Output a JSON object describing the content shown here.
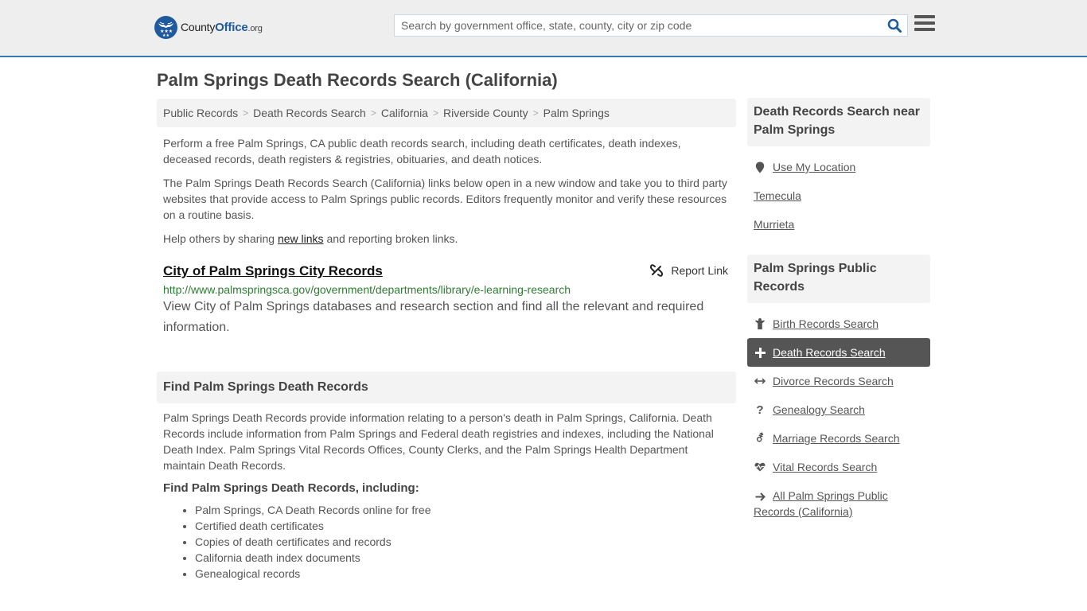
{
  "header": {
    "logo": {
      "name_prefix": "County",
      "name_brand": "Office",
      "name_suffix": ".org"
    },
    "search": {
      "placeholder": "Search by government office, state, county, city or zip code",
      "value": ""
    },
    "colors": {
      "brand": "#1f5a9f",
      "accent_border": "#337ab7",
      "header_bg": "#eeeeee"
    }
  },
  "page": {
    "title": "Palm Springs Death Records Search (California)"
  },
  "breadcrumb": [
    {
      "label": "Public Records"
    },
    {
      "label": "Death Records Search"
    },
    {
      "label": "California"
    },
    {
      "label": "Riverside County"
    },
    {
      "label": "Palm Springs"
    }
  ],
  "breadcrumb_separator": ">",
  "intro": {
    "p1": "Perform a free Palm Springs, CA public death records search, including death certificates, death indexes, deceased records, death registers & registries, obituaries, and death notices.",
    "p2": "The Palm Springs Death Records Search (California) links below open in a new window and take you to third party websites that provide access to Palm Springs public records. Editors frequently monitor and verify these resources on a routine basis.",
    "p3_before": "Help others by sharing ",
    "p3_link": "new links",
    "p3_after": " and reporting broken links."
  },
  "links": [
    {
      "title": "City of Palm Springs City Records",
      "url": "http://www.palmspringsca.gov/government/departments/library/e-learning-research",
      "description": "View City of Palm Springs databases and research section and find all the relevant and required information.",
      "report_label": "Report Link",
      "report_icon": "unlink-icon"
    }
  ],
  "find_section": {
    "heading": "Find Palm Springs Death Records",
    "body": "Palm Springs Death Records provide information relating to a person's death in Palm Springs, California. Death Records include information from Palm Springs and Federal death registries and indexes, including the National Death Index. Palm Springs Vital Records Offices, County Clerks, and the Palm Springs Health Department maintain Death Records.",
    "subheading": "Find Palm Springs Death Records, including:",
    "items": [
      "Palm Springs, CA Death Records online for free",
      "Certified death certificates",
      "Copies of death certificates and records",
      "California death index documents",
      "Genealogical records"
    ]
  },
  "sidebar": {
    "nearby": {
      "heading": "Death Records Search near Palm Springs",
      "use_location": {
        "label": "Use My Location",
        "icon": "map-marker-icon"
      },
      "cities": [
        "Temecula",
        "Murrieta"
      ]
    },
    "public_records": {
      "heading": "Palm Springs Public Records",
      "items": [
        {
          "label": "Birth Records Search",
          "icon": "child-icon",
          "active": false
        },
        {
          "label": "Death Records Search",
          "icon": "plus-icon",
          "active": true
        },
        {
          "label": "Divorce Records Search",
          "icon": "arrows-horizontal-icon",
          "active": false
        },
        {
          "label": "Genealogy Search",
          "icon": "question-icon",
          "active": false
        },
        {
          "label": "Marriage Records Search",
          "icon": "venus-mars-icon",
          "active": false
        },
        {
          "label": "Vital Records Search",
          "icon": "heartbeat-icon",
          "active": false
        },
        {
          "label": "All Palm Springs Public Records (California)",
          "icon": "arrow-right-icon",
          "active": false
        }
      ]
    }
  }
}
